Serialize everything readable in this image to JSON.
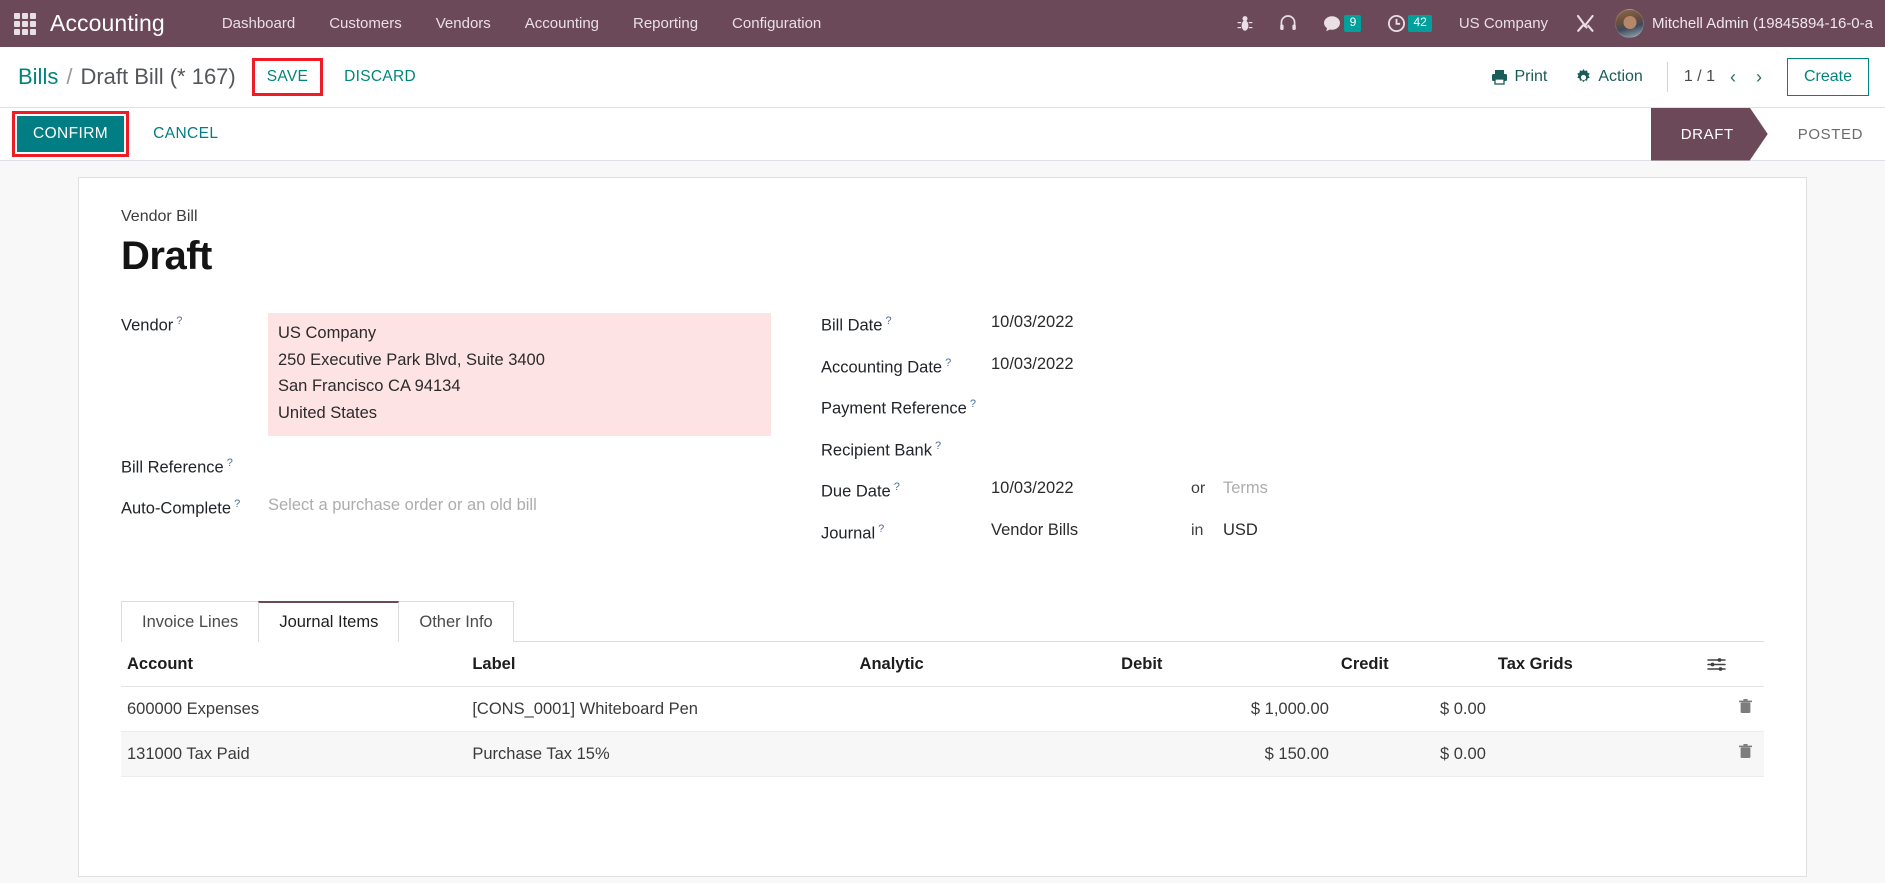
{
  "navbar": {
    "brand": "Accounting",
    "apps_icon": "apps-grid-icon",
    "menu": [
      {
        "label": "Dashboard"
      },
      {
        "label": "Customers"
      },
      {
        "label": "Vendors"
      },
      {
        "label": "Accounting"
      },
      {
        "label": "Reporting"
      },
      {
        "label": "Configuration"
      }
    ],
    "icons": [
      {
        "name": "bug-icon",
        "badge": ""
      },
      {
        "name": "support-headset-icon",
        "badge": ""
      },
      {
        "name": "messages-icon",
        "badge": "9"
      },
      {
        "name": "activity-clock-icon",
        "badge": "42"
      }
    ],
    "company": "US Company",
    "tools_icon": "wrench-screwdriver-icon",
    "user": "Mitchell Admin (19845894-16-0-a"
  },
  "control_panel": {
    "breadcrumb_root": "Bills",
    "breadcrumb_separator": "/",
    "breadcrumb_current": "Draft Bill (* 167)",
    "save_label": "SAVE",
    "discard_label": "DISCARD",
    "print_label": "Print",
    "action_label": "Action",
    "pager": "1 / 1",
    "prev_arrow": "‹",
    "next_arrow": "›",
    "create_label": "Create"
  },
  "statusbar": {
    "confirm_label": "CONFIRM",
    "cancel_label": "CANCEL",
    "stages": [
      {
        "label": "DRAFT",
        "active": true
      },
      {
        "label": "POSTED",
        "active": false
      }
    ]
  },
  "document": {
    "subtitle": "Vendor Bill",
    "title": "Draft",
    "left_fields": {
      "vendor_label": "Vendor",
      "vendor_value": [
        "US Company",
        "250 Executive Park Blvd, Suite 3400",
        "San Francisco CA 94134",
        "United States"
      ],
      "bill_reference_label": "Bill Reference",
      "bill_reference_value": "",
      "auto_complete_label": "Auto-Complete",
      "auto_complete_placeholder": "Select a purchase order or an old bill"
    },
    "right_fields": {
      "bill_date_label": "Bill Date",
      "bill_date_value": "10/03/2022",
      "accounting_date_label": "Accounting Date",
      "accounting_date_value": "10/03/2022",
      "payment_reference_label": "Payment Reference",
      "payment_reference_value": "",
      "recipient_bank_label": "Recipient Bank",
      "recipient_bank_value": "",
      "due_date_label": "Due Date",
      "due_date_value": "10/03/2022",
      "due_date_conjunction": "or",
      "terms_placeholder": "Terms",
      "journal_label": "Journal",
      "journal_value": "Vendor Bills",
      "journal_conjunction": "in",
      "currency_value": "USD"
    },
    "tooltip_marker": "?"
  },
  "tabs": [
    {
      "label": "Invoice Lines",
      "active": false
    },
    {
      "label": "Journal Items",
      "active": true
    },
    {
      "label": "Other Info",
      "active": false
    }
  ],
  "table": {
    "columns": [
      "Account",
      "Label",
      "Analytic",
      "Debit",
      "Credit",
      "Tax Grids"
    ],
    "optional_columns_icon": "column-settings-icon",
    "row_delete_icon": "trash-icon",
    "rows": [
      {
        "account": "600000 Expenses",
        "label": "[CONS_0001] Whiteboard Pen",
        "analytic": "",
        "debit": "$ 1,000.00",
        "credit": "$ 0.00",
        "tax_grids": ""
      },
      {
        "account": "131000 Tax Paid",
        "label": "Purchase Tax 15%",
        "analytic": "",
        "debit": "$ 150.00",
        "credit": "$ 0.00",
        "tax_grids": ""
      }
    ]
  },
  "colors": {
    "brand_purple": "#6b4958",
    "accent_teal": "#00857d",
    "confirm_teal": "#017e84",
    "badge_teal": "#00a09d",
    "highlight_red": "#ee1c25",
    "vendor_highlight_pink": "#fde3e3"
  }
}
